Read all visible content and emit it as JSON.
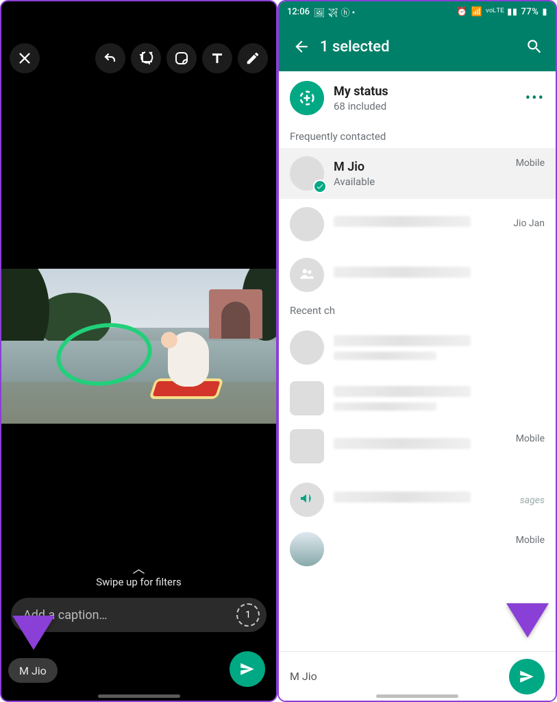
{
  "left": {
    "toolbar_icons": [
      "close",
      "undo",
      "crop-rotate",
      "sticker",
      "text",
      "draw"
    ],
    "filters_hint": "Swipe up for filters",
    "caption_placeholder": "Add a caption…",
    "hd_label": "1",
    "recipient": "M Jio"
  },
  "right": {
    "statusbar": {
      "time": "12:06",
      "battery": "77%"
    },
    "appbar": {
      "title": "1 selected"
    },
    "my_status": {
      "title": "My status",
      "subtitle": "68 included"
    },
    "section_frequent": "Frequently contacted",
    "section_recent": "Recent ch",
    "contacts": {
      "selected": {
        "name": "M Jio",
        "status": "Available",
        "type": "Mobile"
      },
      "jio": {
        "label": "Jio Jan"
      },
      "types": {
        "mobile": "Mobile"
      },
      "sages": "sages"
    },
    "bottom": {
      "chip": "M Jio"
    }
  }
}
